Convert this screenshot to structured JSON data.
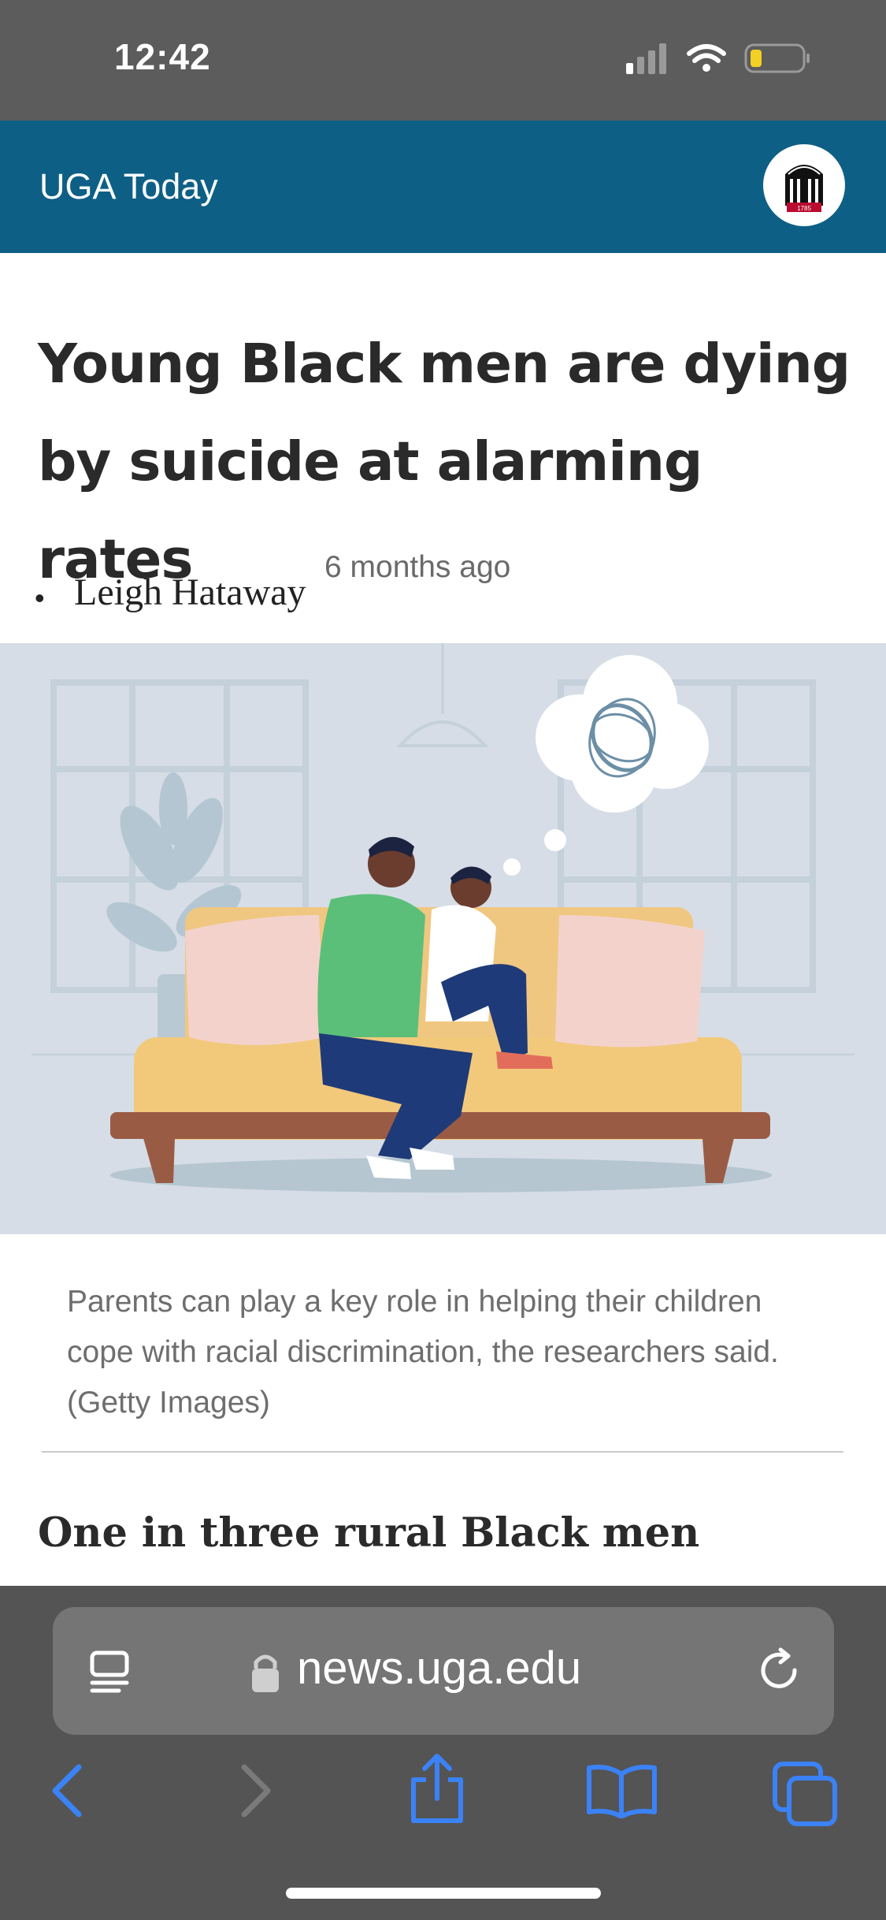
{
  "status_bar": {
    "time": "12:42",
    "icons": [
      "cellular-signal-icon",
      "wifi-icon",
      "battery-low-icon"
    ]
  },
  "site_header": {
    "title": "UGA Today",
    "logo_name": "uga-arch-logo-icon",
    "logo_text": "1785",
    "background_color": "#0e5f85"
  },
  "article": {
    "title": "Young Black men are dying by suicide at alarming rates",
    "author": "Leigh Hataway",
    "date": "6 months ago",
    "hero_image": {
      "illustration": "father-comforting-son-on-couch"
    },
    "caption": "Parents can play a key role in helping their children cope with racial discrimination, the researchers said. (Getty Images)",
    "lead": "One in three rural Black men reported they experienced suicidal ideation or"
  },
  "browser": {
    "url": "news.uga.edu",
    "reader_icon": "reader-mode-icon",
    "lock_icon": "lock-icon",
    "reload_icon": "reload-icon",
    "toolbar": [
      "back-icon",
      "forward-icon",
      "share-icon",
      "bookmarks-icon",
      "tabs-icon"
    ],
    "accent_color": "#3b82f6"
  }
}
